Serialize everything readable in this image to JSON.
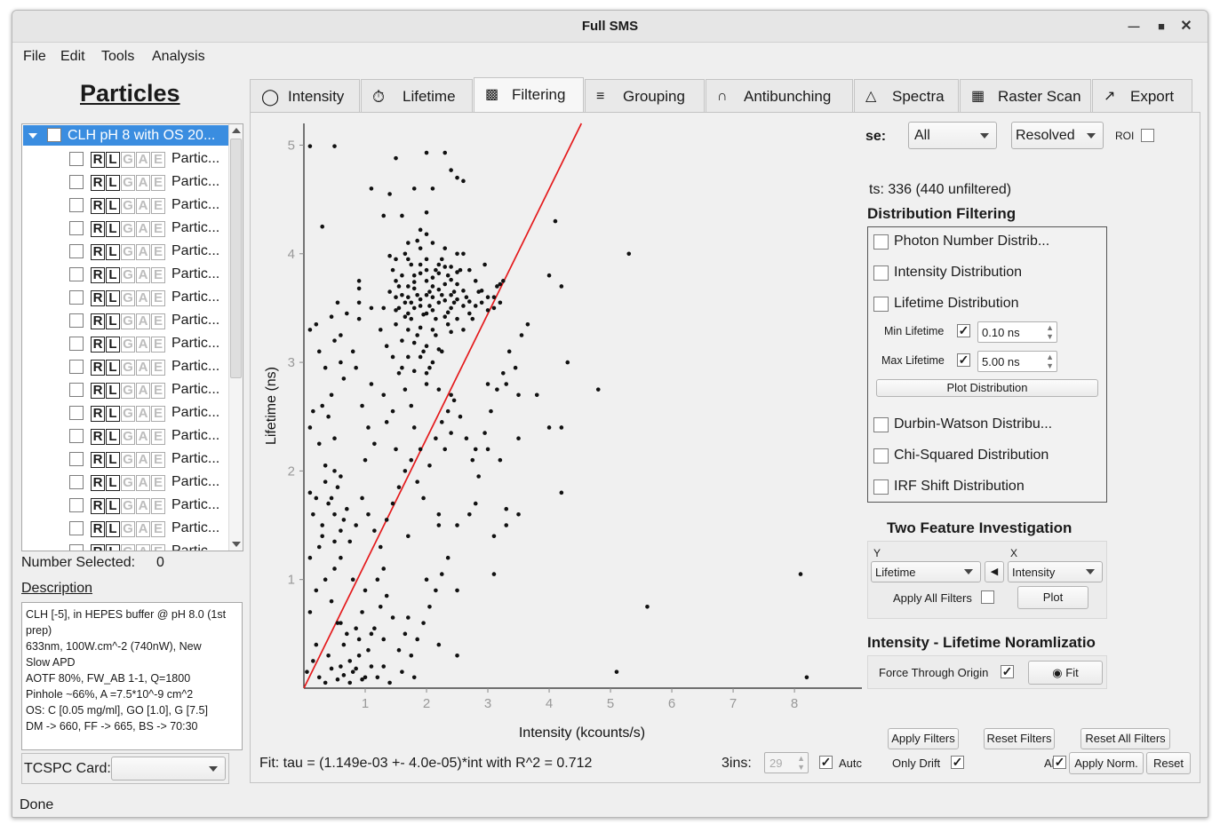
{
  "window": {
    "title": "Full SMS"
  },
  "menu": [
    "File",
    "Edit",
    "Tools",
    "Analysis"
  ],
  "left_panel": {
    "title": "Particles",
    "root_label": "CLH pH 8 with OS 20...",
    "particle_label": "Partic...",
    "row_letters": [
      "R",
      "L",
      "G",
      "A",
      "E"
    ],
    "number_selected_label": "Number Selected:",
    "number_selected_value": "0",
    "description_title": "Description",
    "description_lines": [
      "CLH [-5], in HEPES buffer @ pH 8.0 (1st",
      "prep)",
      "633nm, 100W.cm^-2 (740nW), New",
      "Slow APD",
      "AOTF 80%, FW_AB 1-1, Q=1800",
      "Pinhole ~66%, A =7.5*10^-9 cm^2",
      "OS: C [0.05 mg/ml], GO [1.0], G [7.5]",
      "DM -> 660, FF -> 665, BS -> 70:30"
    ],
    "tcspc_label": "TCSPC Card:",
    "tcspc_value": ""
  },
  "tabs": [
    "Intensity",
    "Lifetime",
    "Filtering",
    "Grouping",
    "Antibunching",
    "Spectra",
    "Raster Scan",
    "Export"
  ],
  "active_tab": "Filtering",
  "filter_top": {
    "use_label": "se:",
    "use_value": "All",
    "mode_value": "Resolved",
    "roi_label": "ROI",
    "points_text": "ts: 336 (440 unfiltered)"
  },
  "distribution": {
    "title": "Distribution Filtering",
    "items": [
      "Photon Number Distrib...",
      "Intensity Distribution",
      "Lifetime Distribution",
      "Durbin-Watson Distribu...",
      "Chi-Squared Distribution",
      "IRF Shift Distribution"
    ],
    "min_label": "Min Lifetime",
    "min_value": "0.10 ns",
    "max_label": "Max Lifetime",
    "max_value": "5.00 ns",
    "plot_button": "Plot Distribution"
  },
  "two_feature": {
    "title": "Two Feature Investigation",
    "y_label": "Y",
    "x_label": "X",
    "y_value": "Lifetime",
    "x_value": "Intensity",
    "apply_all_label": "Apply All Filters",
    "plot_button": "Plot"
  },
  "normalization": {
    "title": "Intensity - Lifetime Noramlizatio",
    "force_label": "Force Through Origin",
    "fit_button": "Fit"
  },
  "bottom": {
    "fit_text": "Fit: tau = (1.149e-03 +- 4.0e-05)*int  with R^2 = 0.712",
    "bins_label": "3ins:",
    "bins_value": "29",
    "auto_label": "Autc",
    "apply_filters": "Apply Filters",
    "reset_filters": "Reset Filters",
    "reset_all": "Reset All Filters",
    "only_drift": "Only Drift",
    "all_label": "All",
    "apply_norm": "Apply Norm.",
    "reset": "Reset"
  },
  "status": "Done",
  "chart_data": {
    "type": "scatter",
    "xlabel": "Intensity (kcounts/s)",
    "ylabel": "Lifetime (ns)",
    "xlim": [
      0,
      9.1
    ],
    "ylim": [
      0,
      5.2
    ],
    "xticks": [
      1,
      2,
      3,
      4,
      5,
      6,
      7,
      8
    ],
    "yticks": [
      1,
      2,
      3,
      4,
      5
    ],
    "fit_line": {
      "slope": 1.149,
      "intercept": 0,
      "color": "#e41a1c"
    },
    "points": [
      [
        0.1,
        4.99
      ],
      [
        0.5,
        4.99
      ],
      [
        1.5,
        4.88
      ],
      [
        2.0,
        4.93
      ],
      [
        2.3,
        4.93
      ],
      [
        2.4,
        4.77
      ],
      [
        2.5,
        4.7
      ],
      [
        2.6,
        4.67
      ],
      [
        1.1,
        4.6
      ],
      [
        1.4,
        4.55
      ],
      [
        1.8,
        4.6
      ],
      [
        2.1,
        4.6
      ],
      [
        1.3,
        4.35
      ],
      [
        1.6,
        4.35
      ],
      [
        2.0,
        4.38
      ],
      [
        0.3,
        4.25
      ],
      [
        1.9,
        4.22
      ],
      [
        2.0,
        4.18
      ],
      [
        1.7,
        4.1
      ],
      [
        1.9,
        4.05
      ],
      [
        2.1,
        4.1
      ],
      [
        2.3,
        4.05
      ],
      [
        2.5,
        4.0
      ],
      [
        2.6,
        4.0
      ],
      [
        1.4,
        3.98
      ],
      [
        1.5,
        3.95
      ],
      [
        1.7,
        3.95
      ],
      [
        2.0,
        3.95
      ],
      [
        2.2,
        3.9
      ],
      [
        2.4,
        3.88
      ],
      [
        2.7,
        3.85
      ],
      [
        1.9,
        3.82
      ],
      [
        1.6,
        3.8
      ],
      [
        1.5,
        3.75
      ],
      [
        1.8,
        3.74
      ],
      [
        2.0,
        3.75
      ],
      [
        2.1,
        3.7
      ],
      [
        2.3,
        3.72
      ],
      [
        2.5,
        3.72
      ],
      [
        2.8,
        3.75
      ],
      [
        3.2,
        3.72
      ],
      [
        0.9,
        3.75
      ],
      [
        0.9,
        3.68
      ],
      [
        1.4,
        3.65
      ],
      [
        1.5,
        3.6
      ],
      [
        1.7,
        3.6
      ],
      [
        1.9,
        3.58
      ],
      [
        2.1,
        3.6
      ],
      [
        2.2,
        3.55
      ],
      [
        2.4,
        3.5
      ],
      [
        2.6,
        3.52
      ],
      [
        2.9,
        3.55
      ],
      [
        3.1,
        3.6
      ],
      [
        0.9,
        3.55
      ],
      [
        1.1,
        3.5
      ],
      [
        1.3,
        3.5
      ],
      [
        1.5,
        3.48
      ],
      [
        1.7,
        3.45
      ],
      [
        1.8,
        3.5
      ],
      [
        2.0,
        3.45
      ],
      [
        2.3,
        3.42
      ],
      [
        2.5,
        3.4
      ],
      [
        2.7,
        3.45
      ],
      [
        3.0,
        3.48
      ],
      [
        0.9,
        3.4
      ],
      [
        1.5,
        3.35
      ],
      [
        1.7,
        3.3
      ],
      [
        1.9,
        3.32
      ],
      [
        2.1,
        3.3
      ],
      [
        2.4,
        3.28
      ],
      [
        2.6,
        3.3
      ],
      [
        0.1,
        3.3
      ],
      [
        0.2,
        3.35
      ],
      [
        0.45,
        3.42
      ],
      [
        1.6,
        3.2
      ],
      [
        1.8,
        3.18
      ],
      [
        2.0,
        3.15
      ],
      [
        2.2,
        3.12
      ],
      [
        1.7,
        3.05
      ],
      [
        1.9,
        3.05
      ],
      [
        2.1,
        3.0
      ],
      [
        1.6,
        2.95
      ],
      [
        1.8,
        2.92
      ],
      [
        2.0,
        2.9
      ],
      [
        0.5,
        3.2
      ],
      [
        0.6,
        3.0
      ],
      [
        0.65,
        2.85
      ],
      [
        1.1,
        2.8
      ],
      [
        1.3,
        2.7
      ],
      [
        2.0,
        2.8
      ],
      [
        2.2,
        2.75
      ],
      [
        2.4,
        2.7
      ],
      [
        3.0,
        2.8
      ],
      [
        3.3,
        2.8
      ],
      [
        3.5,
        2.7
      ],
      [
        3.8,
        2.7
      ],
      [
        0.3,
        2.6
      ],
      [
        0.4,
        2.5
      ],
      [
        0.1,
        2.4
      ],
      [
        0.5,
        2.3
      ],
      [
        1.8,
        2.4
      ],
      [
        2.4,
        2.35
      ],
      [
        4.0,
        2.4
      ],
      [
        4.2,
        2.4
      ],
      [
        4.8,
        2.75
      ],
      [
        1.0,
        2.1
      ],
      [
        1.5,
        2.2
      ],
      [
        1.9,
        2.2
      ],
      [
        2.3,
        2.2
      ],
      [
        2.8,
        2.2
      ],
      [
        3.0,
        2.2
      ],
      [
        3.2,
        2.1
      ],
      [
        3.5,
        2.3
      ],
      [
        0.5,
        2.0
      ],
      [
        0.6,
        1.95
      ],
      [
        0.1,
        1.8
      ],
      [
        0.2,
        1.75
      ],
      [
        0.4,
        1.7
      ],
      [
        0.5,
        1.6
      ],
      [
        0.3,
        1.5
      ],
      [
        0.6,
        1.45
      ],
      [
        0.5,
        1.35
      ],
      [
        0.6,
        1.2
      ],
      [
        1.3,
        1.1
      ],
      [
        2.0,
        1.0
      ],
      [
        2.5,
        0.9
      ],
      [
        2.2,
        0.4
      ],
      [
        2.5,
        0.3
      ],
      [
        1.7,
        0.65
      ],
      [
        0.1,
        1.2
      ],
      [
        0.2,
        0.9
      ],
      [
        0.1,
        0.7
      ],
      [
        0.2,
        0.4
      ],
      [
        0.4,
        0.3
      ],
      [
        0.6,
        0.2
      ],
      [
        0.8,
        0.15
      ],
      [
        1.0,
        0.1
      ],
      [
        1.2,
        0.1
      ],
      [
        1.4,
        0.05
      ],
      [
        1.6,
        0.15
      ],
      [
        1.8,
        0.1
      ],
      [
        0.7,
        0.5
      ],
      [
        0.9,
        0.45
      ],
      [
        1.1,
        0.5
      ],
      [
        1.3,
        0.45
      ],
      [
        0.8,
        1.0
      ],
      [
        1.0,
        0.9
      ],
      [
        1.2,
        1.0
      ],
      [
        4.2,
        1.8
      ],
      [
        4.3,
        3.0
      ],
      [
        5.3,
        4.0
      ],
      [
        8.1,
        1.05
      ],
      [
        8.2,
        0.1
      ],
      [
        5.1,
        0.15
      ],
      [
        5.6,
        0.75
      ],
      [
        4.0,
        3.8
      ],
      [
        4.1,
        4.3
      ],
      [
        4.2,
        3.7
      ],
      [
        2.7,
        1.6
      ],
      [
        3.1,
        1.4
      ],
      [
        3.3,
        1.5
      ],
      [
        3.5,
        1.6
      ],
      [
        3.1,
        1.05
      ],
      [
        2.2,
        1.5
      ],
      [
        2.5,
        1.5
      ],
      [
        1.7,
        1.4
      ],
      [
        2.2,
        1.6
      ],
      [
        2.8,
        1.7
      ],
      [
        3.3,
        1.65
      ],
      [
        0.3,
        1.4
      ],
      [
        0.5,
        1.1
      ],
      [
        0.6,
        0.6
      ],
      [
        0.9,
        0.3
      ],
      [
        1.1,
        0.2
      ],
      [
        1.3,
        0.2
      ],
      [
        0.35,
        1.9
      ],
      [
        0.45,
        1.75
      ],
      [
        0.55,
        1.85
      ],
      [
        0.65,
        1.55
      ],
      [
        0.7,
        1.65
      ],
      [
        0.75,
        1.35
      ],
      [
        0.85,
        1.5
      ],
      [
        0.95,
        1.75
      ],
      [
        1.05,
        1.6
      ],
      [
        1.15,
        1.45
      ],
      [
        1.25,
        1.3
      ],
      [
        1.35,
        1.55
      ],
      [
        1.45,
        1.7
      ],
      [
        1.55,
        1.85
      ],
      [
        1.65,
        2.0
      ],
      [
        1.75,
        2.1
      ],
      [
        1.85,
        1.9
      ],
      [
        1.95,
        1.75
      ],
      [
        2.05,
        2.05
      ],
      [
        2.15,
        2.3
      ],
      [
        2.25,
        2.45
      ],
      [
        2.35,
        2.55
      ],
      [
        2.45,
        2.65
      ],
      [
        2.55,
        2.5
      ],
      [
        2.65,
        2.3
      ],
      [
        2.75,
        2.1
      ],
      [
        2.85,
        1.95
      ],
      [
        2.95,
        2.35
      ],
      [
        3.05,
        2.55
      ],
      [
        3.15,
        2.75
      ],
      [
        3.25,
        2.9
      ],
      [
        3.35,
        3.1
      ],
      [
        3.45,
        2.95
      ],
      [
        3.55,
        3.25
      ],
      [
        3.65,
        3.35
      ],
      [
        2.05,
        3.65
      ],
      [
        2.15,
        3.85
      ],
      [
        2.25,
        3.95
      ],
      [
        2.35,
        3.8
      ],
      [
        2.45,
        3.65
      ],
      [
        2.55,
        3.85
      ],
      [
        2.65,
        3.6
      ],
      [
        2.75,
        3.4
      ],
      [
        2.85,
        3.65
      ],
      [
        2.95,
        3.9
      ],
      [
        1.45,
        3.85
      ],
      [
        1.55,
        3.7
      ],
      [
        1.65,
        3.55
      ],
      [
        1.75,
        3.4
      ],
      [
        1.85,
        3.25
      ],
      [
        1.95,
        3.1
      ],
      [
        2.05,
        2.95
      ],
      [
        2.15,
        3.25
      ],
      [
        2.25,
        3.1
      ],
      [
        2.35,
        3.35
      ],
      [
        1.25,
        3.3
      ],
      [
        1.35,
        3.15
      ],
      [
        1.45,
        3.05
      ],
      [
        1.55,
        2.9
      ],
      [
        1.65,
        2.75
      ],
      [
        1.75,
        2.6
      ],
      [
        0.25,
        3.1
      ],
      [
        0.35,
        2.95
      ],
      [
        0.45,
        2.7
      ],
      [
        0.15,
        2.55
      ],
      [
        0.25,
        2.25
      ],
      [
        0.35,
        2.05
      ],
      [
        0.15,
        1.6
      ],
      [
        0.25,
        1.3
      ],
      [
        0.35,
        1.0
      ],
      [
        0.45,
        0.8
      ],
      [
        0.55,
        0.6
      ],
      [
        0.65,
        0.4
      ],
      [
        0.75,
        0.25
      ],
      [
        0.85,
        0.55
      ],
      [
        0.95,
        0.7
      ],
      [
        1.05,
        0.35
      ],
      [
        1.15,
        0.55
      ],
      [
        1.25,
        0.75
      ],
      [
        1.35,
        0.85
      ],
      [
        1.45,
        0.65
      ],
      [
        1.55,
        0.35
      ],
      [
        1.65,
        0.5
      ],
      [
        1.75,
        0.3
      ],
      [
        1.85,
        0.45
      ],
      [
        1.95,
        0.6
      ],
      [
        2.05,
        0.75
      ],
      [
        2.15,
        0.9
      ],
      [
        2.25,
        1.05
      ],
      [
        2.35,
        1.2
      ],
      [
        0.05,
        0.15
      ],
      [
        0.15,
        0.25
      ],
      [
        0.25,
        0.1
      ],
      [
        0.35,
        0.05
      ],
      [
        0.45,
        0.18
      ],
      [
        0.55,
        0.08
      ],
      [
        0.65,
        0.12
      ],
      [
        0.75,
        0.05
      ],
      [
        0.85,
        0.18
      ],
      [
        0.95,
        0.08
      ],
      [
        1.8,
        3.68
      ],
      [
        1.9,
        3.52
      ],
      [
        2.0,
        3.62
      ],
      [
        2.1,
        3.48
      ],
      [
        2.2,
        3.67
      ],
      [
        2.3,
        3.57
      ],
      [
        2.4,
        3.62
      ],
      [
        2.5,
        3.58
      ],
      [
        2.6,
        3.66
      ],
      [
        2.7,
        3.56
      ],
      [
        1.6,
        3.62
      ],
      [
        1.7,
        3.7
      ],
      [
        1.8,
        3.8
      ],
      [
        1.9,
        3.9
      ],
      [
        2.0,
        3.85
      ],
      [
        2.1,
        3.78
      ],
      [
        2.2,
        3.82
      ],
      [
        2.3,
        3.88
      ],
      [
        2.4,
        3.76
      ],
      [
        2.5,
        3.83
      ],
      [
        1.55,
        3.5
      ],
      [
        1.65,
        3.42
      ],
      [
        1.75,
        3.55
      ],
      [
        1.85,
        3.62
      ],
      [
        1.95,
        3.44
      ],
      [
        2.05,
        3.52
      ],
      [
        2.15,
        3.4
      ],
      [
        2.25,
        3.62
      ],
      [
        2.35,
        3.46
      ],
      [
        2.45,
        3.55
      ],
      [
        3.0,
        3.6
      ],
      [
        3.1,
        3.5
      ],
      [
        3.2,
        3.55
      ],
      [
        2.9,
        3.66
      ],
      [
        2.8,
        3.52
      ],
      [
        3.15,
        3.7
      ],
      [
        3.25,
        3.75
      ],
      [
        1.75,
        3.9
      ],
      [
        1.65,
        4.0
      ],
      [
        1.85,
        4.12
      ],
      [
        0.55,
        3.55
      ],
      [
        0.6,
        3.25
      ],
      [
        0.7,
        3.45
      ],
      [
        0.8,
        3.1
      ],
      [
        0.85,
        2.95
      ],
      [
        0.95,
        2.6
      ],
      [
        1.05,
        2.4
      ],
      [
        1.15,
        2.25
      ],
      [
        1.35,
        2.45
      ],
      [
        1.45,
        2.55
      ]
    ]
  }
}
